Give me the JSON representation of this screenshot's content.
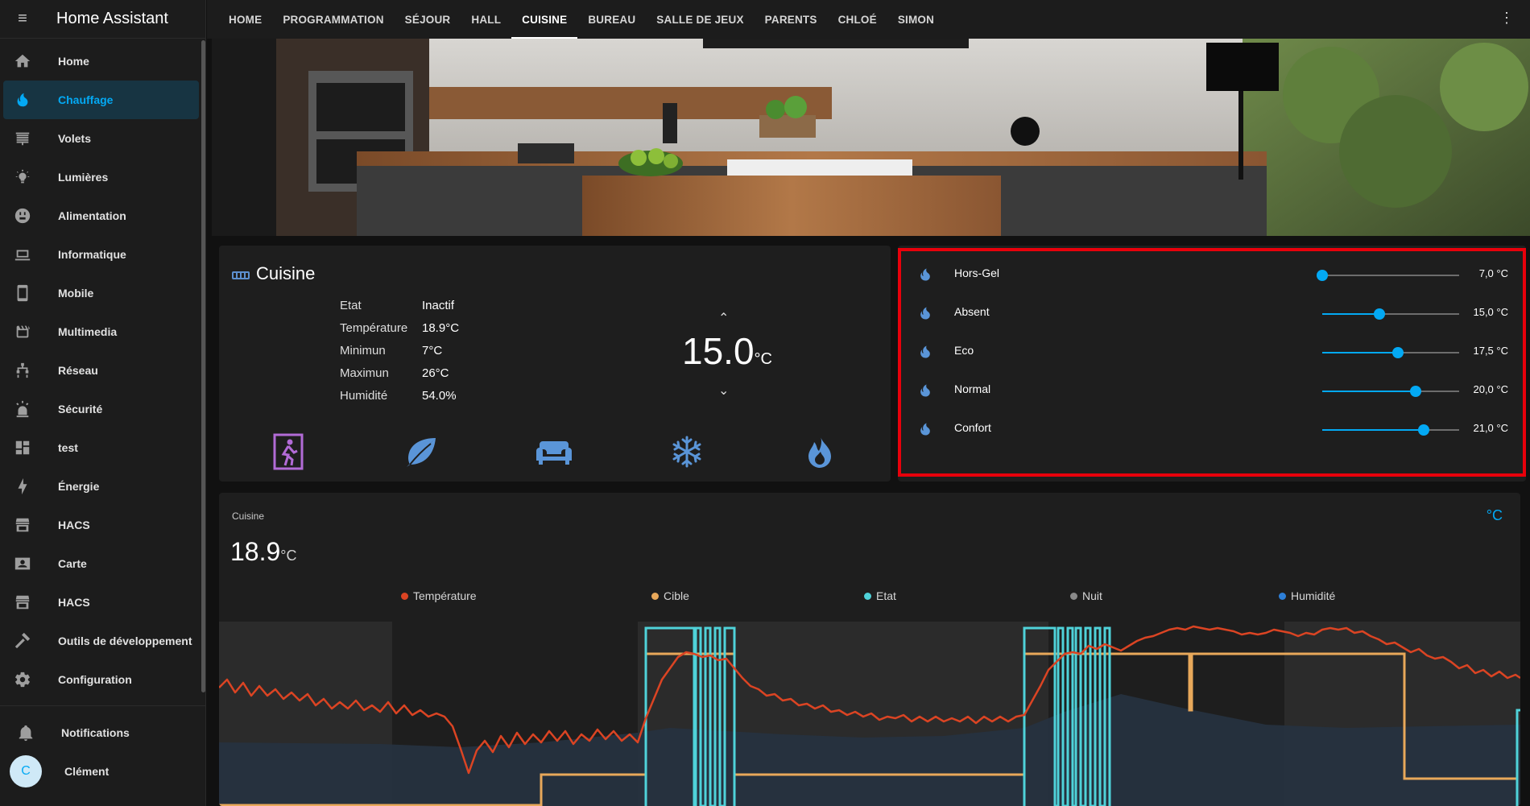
{
  "app": {
    "title": "Home Assistant"
  },
  "sidebar": {
    "items": [
      {
        "label": "Home",
        "icon": "home-icon"
      },
      {
        "label": "Chauffage",
        "icon": "fire-icon",
        "active": true
      },
      {
        "label": "Volets",
        "icon": "blinds-icon"
      },
      {
        "label": "Lumières",
        "icon": "lightbulb-icon"
      },
      {
        "label": "Alimentation",
        "icon": "power-socket-icon"
      },
      {
        "label": "Informatique",
        "icon": "laptop-icon"
      },
      {
        "label": "Mobile",
        "icon": "cellphone-icon"
      },
      {
        "label": "Multimedia",
        "icon": "clapperboard-icon"
      },
      {
        "label": "Réseau",
        "icon": "network-icon"
      },
      {
        "label": "Sécurité",
        "icon": "alarm-light-icon"
      },
      {
        "label": "test",
        "icon": "dashboard-icon"
      },
      {
        "label": "Énergie",
        "icon": "lightning-icon"
      },
      {
        "label": "HACS",
        "icon": "hacs-icon"
      },
      {
        "label": "Carte",
        "icon": "map-account-icon"
      },
      {
        "label": "HACS",
        "icon": "hacs-icon"
      },
      {
        "label": "Outils de développement",
        "icon": "hammer-icon"
      },
      {
        "label": "Configuration",
        "icon": "cog-icon"
      }
    ],
    "notifications_label": "Notifications",
    "user": {
      "name": "Clément",
      "initial": "C"
    }
  },
  "tabs": [
    "HOME",
    "PROGRAMMATION",
    "SÉJOUR",
    "HALL",
    "CUISINE",
    "BUREAU",
    "SALLE DE JEUX",
    "PARENTS",
    "CHLOÉ",
    "SIMON"
  ],
  "active_tab": "CUISINE",
  "thermostat": {
    "name": "Cuisine",
    "attributes": [
      {
        "label": "Etat",
        "value": "Inactif"
      },
      {
        "label": "Température",
        "value": "18.9°C"
      },
      {
        "label": "Minimun",
        "value": "7°C"
      },
      {
        "label": "Maximun",
        "value": "26°C"
      },
      {
        "label": "Humidité",
        "value": "54.0%"
      }
    ],
    "target": "15.0",
    "target_unit": "°C",
    "modes": [
      {
        "icon": "run-fast-door-icon",
        "color": "#b26bd6"
      },
      {
        "icon": "leaf-icon",
        "color": "#5a95d8"
      },
      {
        "icon": "sofa-icon",
        "color": "#5a95d8"
      },
      {
        "icon": "snowflake-icon",
        "color": "#5a95d8"
      },
      {
        "icon": "fire-icon",
        "color": "#5a95d8"
      }
    ]
  },
  "presets": [
    {
      "name": "Hors-Gel",
      "value": "7,0 °C",
      "level": 0.0
    },
    {
      "name": "Absent",
      "value": "15,0 °C",
      "level": 0.42
    },
    {
      "name": "Eco",
      "value": "17,5 °C",
      "level": 0.55
    },
    {
      "name": "Normal",
      "value": "20,0 °C",
      "level": 0.68
    },
    {
      "name": "Confort",
      "value": "21,0 °C",
      "level": 0.74
    }
  ],
  "graph": {
    "name": "Cuisine",
    "value": "18.9",
    "unit": "°C",
    "unit_icon": "°C",
    "legend": [
      {
        "label": "Température",
        "color": "#db4423"
      },
      {
        "label": "Cible",
        "color": "#e8a85a"
      },
      {
        "label": "Etat",
        "color": "#4fd2d9"
      },
      {
        "label": "Nuit",
        "color": "#8a8a8a"
      },
      {
        "label": "Humidité",
        "color": "#2d7fd8"
      }
    ]
  },
  "colors": {
    "accent": "#03a9f4",
    "highlight": "#e8000b",
    "temperature": "#db4423",
    "target": "#e8a85a",
    "state": "#4fd2d9",
    "humidity_area": "#26323f"
  }
}
